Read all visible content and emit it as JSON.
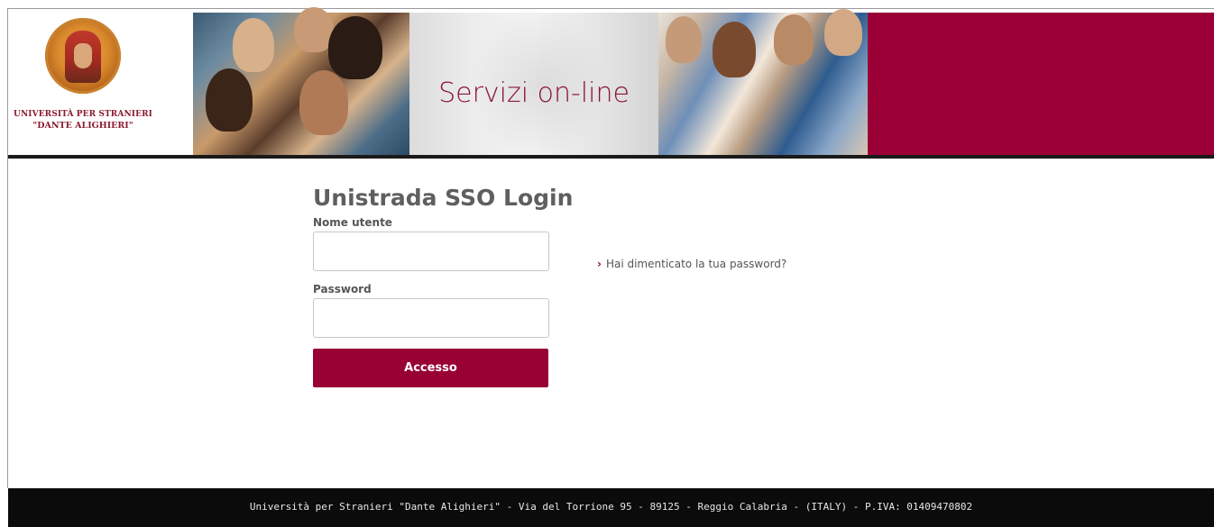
{
  "header": {
    "logo_line1": "UNIVERSITÀ PER STRANIERI",
    "logo_line2": "\"DANTE ALIGHIERI\"",
    "banner_title": "Servizi on-line",
    "accent_color": "#9a0036"
  },
  "login": {
    "title": "Unistrada SSO Login",
    "username_label": "Nome utente",
    "username_value": "",
    "password_label": "Password",
    "password_value": "",
    "submit_label": "Accesso",
    "forgot_chevron": "›",
    "forgot_link": "Hai dimenticato la tua password?"
  },
  "footer": {
    "text": "Università per Stranieri \"Dante Alighieri\" - Via del Torrione 95 - 89125 - Reggio Calabria - (ITALY) - P.IVA: 01409470802"
  },
  "icons": [
    "university-seal-logo",
    "chevron-right-icon"
  ]
}
